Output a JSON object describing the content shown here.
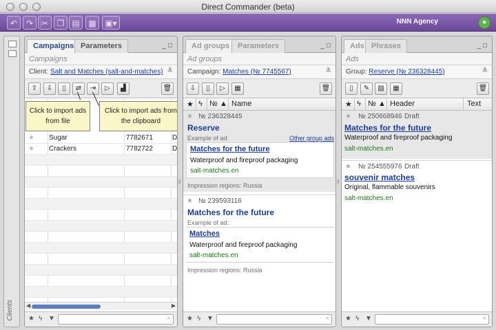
{
  "window": {
    "title": "Direct Commander (beta)"
  },
  "toolbar": {
    "agency": "NNN Agency"
  },
  "sidebar": {
    "label": "Clients"
  },
  "campaigns_panel": {
    "tabs": [
      "Campaigns",
      "Parameters"
    ],
    "subtitle": "Campaigns",
    "client_label": "Client:",
    "client_value": "Salt and Matches (salt-and-matches)",
    "rows": [
      {
        "name": "Sugar",
        "id": "7782671",
        "extra": "D"
      },
      {
        "name": "Crackers",
        "id": "7782722",
        "extra": "D"
      }
    ],
    "tooltip_import_file": "Click to import ads from file",
    "tooltip_import_clipboard": "Click to import ads from the clipboard"
  },
  "adgroups_panel": {
    "tabs": [
      "Ad groups",
      "Parameters"
    ],
    "subtitle": "Ad groups",
    "campaign_label": "Campaign:",
    "campaign_value": "Matches (№ 7745567)",
    "col_num": "№",
    "col_name": "Name",
    "groups": [
      {
        "number": "№ 236328445",
        "name": "Reserve",
        "example_label": "Example of ad:",
        "other_link": "Other group ads",
        "ad_title": "Matches for the future",
        "ad_text": "Waterproof and fireproof packaging",
        "ad_url": "salt-matches.en",
        "regions": "Impression regions: Russia"
      },
      {
        "number": "№ 239593116",
        "name": "Matches for the future",
        "example_label": "Example of ad:",
        "ad_title": "Matches",
        "ad_text": "Waterproof and fireproof packaging",
        "ad_url": "salt-matches.en",
        "regions": "Impression regions: Russia"
      }
    ]
  },
  "ads_panel": {
    "tabs": [
      "Ads",
      "Phrases"
    ],
    "subtitle": "Ads",
    "group_label": "Group:",
    "group_value": "Reserve (№ 236328445)",
    "col_num": "№",
    "col_header": "Header",
    "col_text": "Text",
    "ads": [
      {
        "number": "№ 250668946",
        "status": "Draft",
        "title": "Matches for the future",
        "text": "Waterproof and fireproof packaging",
        "url": "salt-matches.en"
      },
      {
        "number": "№ 254555976",
        "status": "Draft",
        "title": "souvenir matches",
        "text": "Original, flammable souvenirs",
        "url": "salt-matches.en"
      }
    ]
  }
}
